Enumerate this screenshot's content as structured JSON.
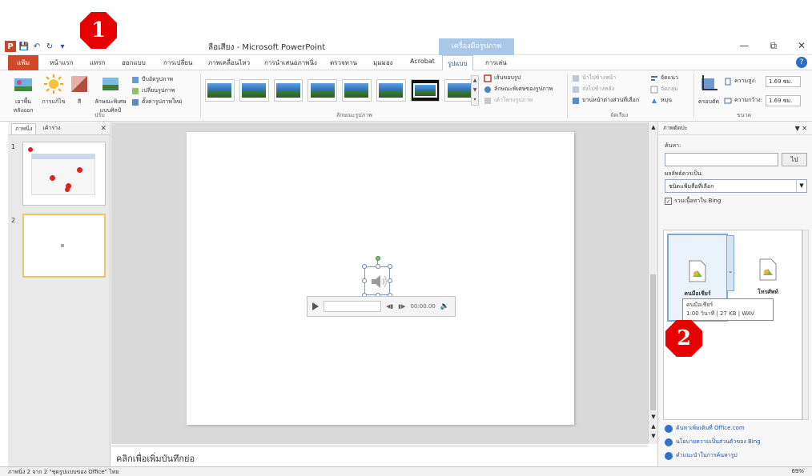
{
  "window": {
    "title": "ลือเสียง - Microsoft PowerPoint",
    "context_tab_title": "เครื่องมือรูปภาพ",
    "ppt_logo": "P"
  },
  "tabs": [
    {
      "label": "แฟ้ม"
    },
    {
      "label": "หน้าแรก"
    },
    {
      "label": "แทรก"
    },
    {
      "label": "ออกแบบ"
    },
    {
      "label": "การเปลี่ยน"
    },
    {
      "label": "ภาพเคลื่อนไหว"
    },
    {
      "label": "การนำเสนอภาพนิ่ง"
    },
    {
      "label": "ตรวจทาน"
    },
    {
      "label": "มุมมอง"
    },
    {
      "label": "Acrobat"
    },
    {
      "label": "รูปแบบ"
    },
    {
      "label": "การเล่น"
    }
  ],
  "ribbon": {
    "adjust_buttons": [
      {
        "label": "เอาพื้นหลังออก"
      },
      {
        "label": "การแก้ไข"
      },
      {
        "label": "สี"
      },
      {
        "label": "ลักษณะพิเศษแบบศิลป์"
      }
    ],
    "adjust_small": [
      "บีบอัดรูปภาพ",
      "เปลี่ยนรูปภาพ",
      "ตั้งค่ารูปภาพใหม่"
    ],
    "adjust_group": "ปรับ",
    "styles_group": "ลักษณะรูปภาพ",
    "style_right": [
      "เส้นขอบรูป",
      "ลักษณะพิเศษของรูปภาพ",
      "เค้าโครงรูปภาพ"
    ],
    "arrange_small": [
      "นำไปข้างหน้า",
      "ส่งไปข้างหลัง",
      "บานหน้าต่างส่วนที่เลือก"
    ],
    "arrange_small2": [
      "จัดแนว",
      "จัดกลุ่ม",
      "หมุน"
    ],
    "arrange_group": "จัดเรียง",
    "crop_label": "ครอบตัด",
    "size_group": "ขนาด",
    "height_label": "ความสูง:",
    "height_value": "1.69 ซม.",
    "width_label": "ความกว้าง:",
    "width_value": "1.69 ซม."
  },
  "left_pane": {
    "tabs": [
      "ภาพนิ่ง",
      "เค้าร่าง"
    ],
    "slides": [
      {
        "num": "1"
      },
      {
        "num": "2"
      }
    ]
  },
  "player": {
    "time": "00:00.00"
  },
  "notes": {
    "placeholder": "คลิกเพื่อเพิ่มบันทึกย่อ"
  },
  "clip_pane": {
    "title": "ภาพตัดปะ",
    "search_label": "ค้นหา:",
    "go_label": "ไป",
    "results_label": "ผลลัพธ์ควรเป็น:",
    "media_type": "ชนิดแฟ้มสื่อที่เลือก",
    "include_bing": "รวมเนื้อหาใน Bing",
    "clips": [
      {
        "caption": "คนมือเชียร์"
      },
      {
        "caption": "โทรศัพท์"
      }
    ],
    "tooltip_line1": "คนมือเชียร์",
    "tooltip_line2": "1:00 วินาที | 27 KB | WAV",
    "links": [
      "ค้นหาเพิ่มเติมที่ Office.com",
      "นโยบายความเป็นส่วนตัวของ Bing",
      "คำแนะนำในการค้นหารูป"
    ]
  },
  "statusbar": {
    "left": "ภาพนิ่ง 2 จาก 2   \"ชุดรูปแบบของ Office\"   ไทย",
    "zoom": "69%"
  },
  "markers": [
    "1",
    "2"
  ],
  "colors": {
    "file_tab": "#d24726",
    "accent_blue": "#2b6cc4",
    "marker_red": "#e60000",
    "selection_border": "#f0c36b"
  }
}
